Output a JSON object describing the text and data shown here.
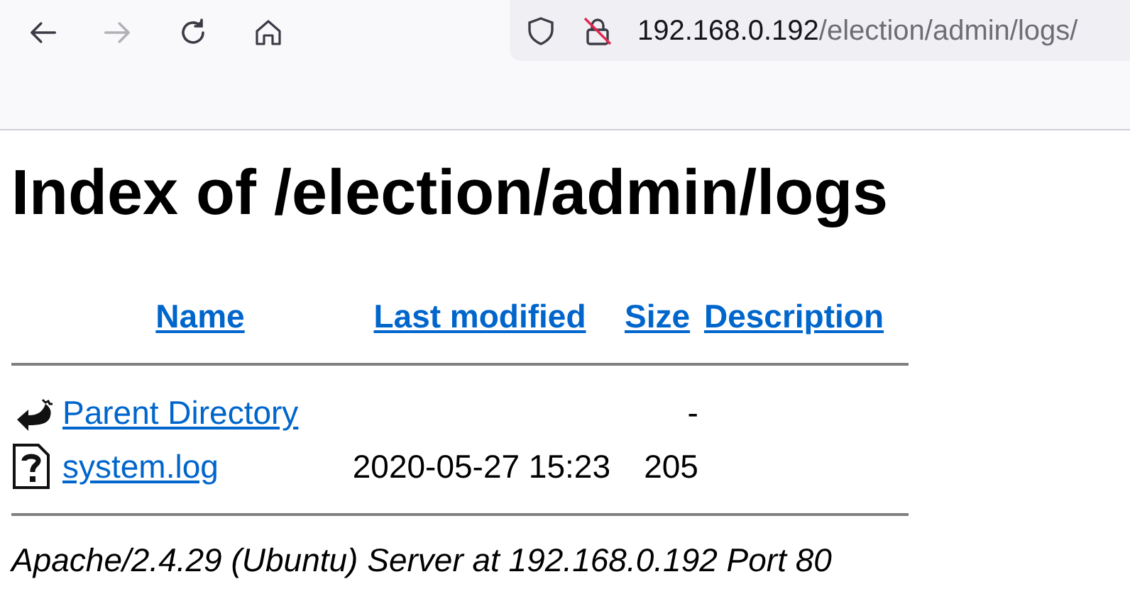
{
  "toolbar": {
    "back": {
      "disabled": false
    },
    "forward": {
      "disabled": true
    },
    "address": {
      "host": "192.168.0.192",
      "path": "/election/admin/logs/"
    }
  },
  "page": {
    "title": "Index of /election/admin/logs",
    "table": {
      "columns": [
        "Name",
        "Last modified",
        "Size",
        "Description"
      ],
      "rows": [
        {
          "kind": "parent",
          "name": "Parent Directory",
          "modified": "",
          "size": "-"
        },
        {
          "kind": "unknown",
          "name": "system.log",
          "modified": "2020-05-27 15:23",
          "size": "205"
        }
      ]
    },
    "footer": "Apache/2.4.29 (Ubuntu) Server at 192.168.0.192 Port 80"
  }
}
